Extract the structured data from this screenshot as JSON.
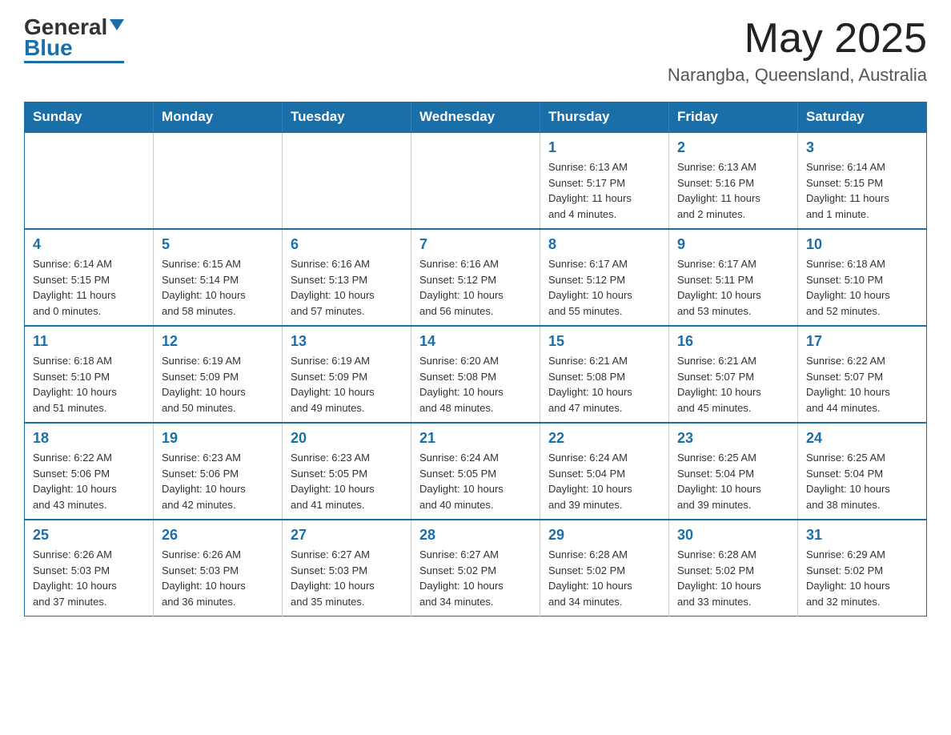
{
  "header": {
    "logo_general": "General",
    "logo_blue": "Blue",
    "month_year": "May 2025",
    "location": "Narangba, Queensland, Australia"
  },
  "days_of_week": [
    "Sunday",
    "Monday",
    "Tuesday",
    "Wednesday",
    "Thursday",
    "Friday",
    "Saturday"
  ],
  "weeks": [
    [
      {
        "day": "",
        "info": ""
      },
      {
        "day": "",
        "info": ""
      },
      {
        "day": "",
        "info": ""
      },
      {
        "day": "",
        "info": ""
      },
      {
        "day": "1",
        "info": "Sunrise: 6:13 AM\nSunset: 5:17 PM\nDaylight: 11 hours\nand 4 minutes."
      },
      {
        "day": "2",
        "info": "Sunrise: 6:13 AM\nSunset: 5:16 PM\nDaylight: 11 hours\nand 2 minutes."
      },
      {
        "day": "3",
        "info": "Sunrise: 6:14 AM\nSunset: 5:15 PM\nDaylight: 11 hours\nand 1 minute."
      }
    ],
    [
      {
        "day": "4",
        "info": "Sunrise: 6:14 AM\nSunset: 5:15 PM\nDaylight: 11 hours\nand 0 minutes."
      },
      {
        "day": "5",
        "info": "Sunrise: 6:15 AM\nSunset: 5:14 PM\nDaylight: 10 hours\nand 58 minutes."
      },
      {
        "day": "6",
        "info": "Sunrise: 6:16 AM\nSunset: 5:13 PM\nDaylight: 10 hours\nand 57 minutes."
      },
      {
        "day": "7",
        "info": "Sunrise: 6:16 AM\nSunset: 5:12 PM\nDaylight: 10 hours\nand 56 minutes."
      },
      {
        "day": "8",
        "info": "Sunrise: 6:17 AM\nSunset: 5:12 PM\nDaylight: 10 hours\nand 55 minutes."
      },
      {
        "day": "9",
        "info": "Sunrise: 6:17 AM\nSunset: 5:11 PM\nDaylight: 10 hours\nand 53 minutes."
      },
      {
        "day": "10",
        "info": "Sunrise: 6:18 AM\nSunset: 5:10 PM\nDaylight: 10 hours\nand 52 minutes."
      }
    ],
    [
      {
        "day": "11",
        "info": "Sunrise: 6:18 AM\nSunset: 5:10 PM\nDaylight: 10 hours\nand 51 minutes."
      },
      {
        "day": "12",
        "info": "Sunrise: 6:19 AM\nSunset: 5:09 PM\nDaylight: 10 hours\nand 50 minutes."
      },
      {
        "day": "13",
        "info": "Sunrise: 6:19 AM\nSunset: 5:09 PM\nDaylight: 10 hours\nand 49 minutes."
      },
      {
        "day": "14",
        "info": "Sunrise: 6:20 AM\nSunset: 5:08 PM\nDaylight: 10 hours\nand 48 minutes."
      },
      {
        "day": "15",
        "info": "Sunrise: 6:21 AM\nSunset: 5:08 PM\nDaylight: 10 hours\nand 47 minutes."
      },
      {
        "day": "16",
        "info": "Sunrise: 6:21 AM\nSunset: 5:07 PM\nDaylight: 10 hours\nand 45 minutes."
      },
      {
        "day": "17",
        "info": "Sunrise: 6:22 AM\nSunset: 5:07 PM\nDaylight: 10 hours\nand 44 minutes."
      }
    ],
    [
      {
        "day": "18",
        "info": "Sunrise: 6:22 AM\nSunset: 5:06 PM\nDaylight: 10 hours\nand 43 minutes."
      },
      {
        "day": "19",
        "info": "Sunrise: 6:23 AM\nSunset: 5:06 PM\nDaylight: 10 hours\nand 42 minutes."
      },
      {
        "day": "20",
        "info": "Sunrise: 6:23 AM\nSunset: 5:05 PM\nDaylight: 10 hours\nand 41 minutes."
      },
      {
        "day": "21",
        "info": "Sunrise: 6:24 AM\nSunset: 5:05 PM\nDaylight: 10 hours\nand 40 minutes."
      },
      {
        "day": "22",
        "info": "Sunrise: 6:24 AM\nSunset: 5:04 PM\nDaylight: 10 hours\nand 39 minutes."
      },
      {
        "day": "23",
        "info": "Sunrise: 6:25 AM\nSunset: 5:04 PM\nDaylight: 10 hours\nand 39 minutes."
      },
      {
        "day": "24",
        "info": "Sunrise: 6:25 AM\nSunset: 5:04 PM\nDaylight: 10 hours\nand 38 minutes."
      }
    ],
    [
      {
        "day": "25",
        "info": "Sunrise: 6:26 AM\nSunset: 5:03 PM\nDaylight: 10 hours\nand 37 minutes."
      },
      {
        "day": "26",
        "info": "Sunrise: 6:26 AM\nSunset: 5:03 PM\nDaylight: 10 hours\nand 36 minutes."
      },
      {
        "day": "27",
        "info": "Sunrise: 6:27 AM\nSunset: 5:03 PM\nDaylight: 10 hours\nand 35 minutes."
      },
      {
        "day": "28",
        "info": "Sunrise: 6:27 AM\nSunset: 5:02 PM\nDaylight: 10 hours\nand 34 minutes."
      },
      {
        "day": "29",
        "info": "Sunrise: 6:28 AM\nSunset: 5:02 PM\nDaylight: 10 hours\nand 34 minutes."
      },
      {
        "day": "30",
        "info": "Sunrise: 6:28 AM\nSunset: 5:02 PM\nDaylight: 10 hours\nand 33 minutes."
      },
      {
        "day": "31",
        "info": "Sunrise: 6:29 AM\nSunset: 5:02 PM\nDaylight: 10 hours\nand 32 minutes."
      }
    ]
  ]
}
